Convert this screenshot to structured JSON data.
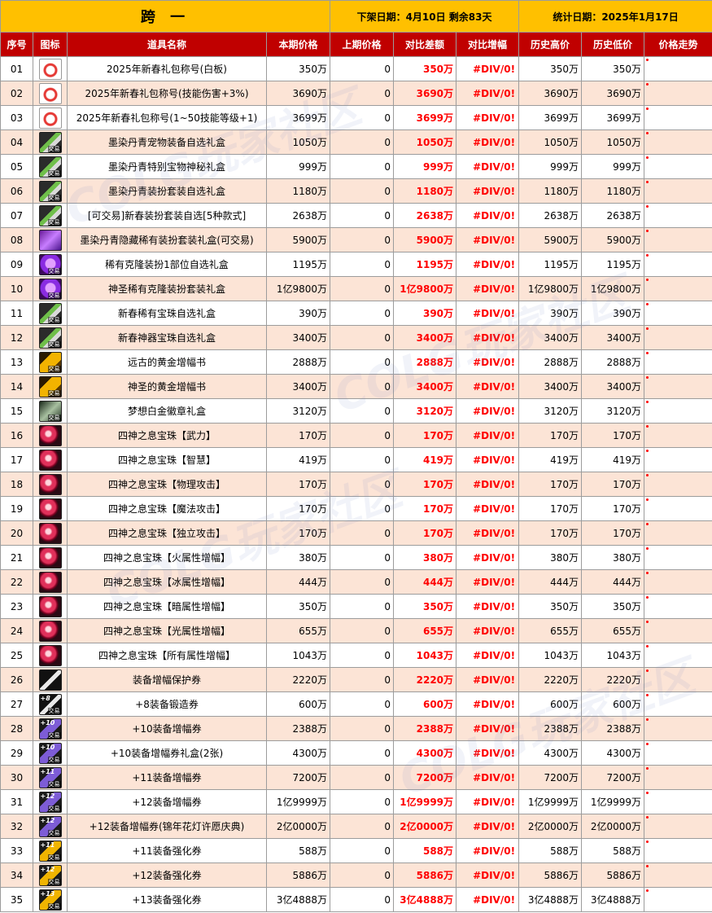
{
  "header": {
    "server": "跨 一",
    "offline_info": "下架日期：4月10日   剩余83天",
    "stat_info": "统计日期：2025年1月17日"
  },
  "columns": [
    "序号",
    "图标",
    "道具名称",
    "本期价格",
    "上期价格",
    "对比差额",
    "对比增幅",
    "历史高价",
    "历史低价",
    "价格走势"
  ],
  "watermark": "COLG玩家社区",
  "rows": [
    {
      "no": "01",
      "icon": "gift-icon",
      "tag": "",
      "name": "2025年新春礼包称号(白板)",
      "price": "350万",
      "prev": "0",
      "diff": "350万",
      "rate": "#DIV/0!",
      "high": "350万",
      "low": "350万"
    },
    {
      "no": "02",
      "icon": "gift-icon",
      "tag": "",
      "name": "2025年新春礼包称号(技能伤害+3%)",
      "price": "3690万",
      "prev": "0",
      "diff": "3690万",
      "rate": "#DIV/0!",
      "high": "3690万",
      "low": "3690万"
    },
    {
      "no": "03",
      "icon": "gift-icon",
      "tag": "",
      "name": "2025年新春礼包称号(1~50技能等级+1)",
      "price": "3699万",
      "prev": "0",
      "diff": "3699万",
      "rate": "#DIV/0!",
      "high": "3699万",
      "low": "3699万"
    },
    {
      "no": "04",
      "icon": "brush-icon",
      "tag": "交易",
      "name": "墨染丹青宠物装备自选礼盒",
      "price": "1050万",
      "prev": "0",
      "diff": "1050万",
      "rate": "#DIV/0!",
      "high": "1050万",
      "low": "1050万"
    },
    {
      "no": "05",
      "icon": "brush-icon",
      "tag": "交易",
      "name": "墨染丹青特别宝物神秘礼盒",
      "price": "999万",
      "prev": "0",
      "diff": "999万",
      "rate": "#DIV/0!",
      "high": "999万",
      "low": "999万"
    },
    {
      "no": "06",
      "icon": "brush-icon",
      "tag": "交易",
      "name": "墨染丹青装扮套装自选礼盒",
      "price": "1180万",
      "prev": "0",
      "diff": "1180万",
      "rate": "#DIV/0!",
      "high": "1180万",
      "low": "1180万"
    },
    {
      "no": "07",
      "icon": "brush-icon",
      "tag": "交易",
      "name": "[可交易]新春装扮套装自选[5种款式]",
      "price": "2638万",
      "prev": "0",
      "diff": "2638万",
      "rate": "#DIV/0!",
      "high": "2638万",
      "low": "2638万"
    },
    {
      "no": "08",
      "icon": "box-icon",
      "tag": "",
      "name": "墨染丹青隐藏稀有装扮套装礼盒(可交易)",
      "price": "5900万",
      "prev": "0",
      "diff": "5900万",
      "rate": "#DIV/0!",
      "high": "5900万",
      "low": "5900万"
    },
    {
      "no": "09",
      "icon": "ghost-icon",
      "tag": "交易",
      "name": "稀有克隆装扮1部位自选礼盒",
      "price": "1195万",
      "prev": "0",
      "diff": "1195万",
      "rate": "#DIV/0!",
      "high": "1195万",
      "low": "1195万"
    },
    {
      "no": "10",
      "icon": "ghost-icon",
      "tag": "交易",
      "name": "神圣稀有克隆装扮套装礼盒",
      "price": "1亿9800万",
      "prev": "0",
      "diff": "1亿9800万",
      "rate": "#DIV/0!",
      "high": "1亿9800万",
      "low": "1亿9800万"
    },
    {
      "no": "11",
      "icon": "brush-icon",
      "tag": "交易",
      "name": "新春稀有宝珠自选礼盒",
      "price": "390万",
      "prev": "0",
      "diff": "390万",
      "rate": "#DIV/0!",
      "high": "390万",
      "low": "390万"
    },
    {
      "no": "12",
      "icon": "brush-icon",
      "tag": "交易",
      "name": "新春神器宝珠自选礼盒",
      "price": "3400万",
      "prev": "0",
      "diff": "3400万",
      "rate": "#DIV/0!",
      "high": "3400万",
      "low": "3400万"
    },
    {
      "no": "13",
      "icon": "book-icon",
      "tag": "交易",
      "name": "远古的黄金增幅书",
      "price": "2888万",
      "prev": "0",
      "diff": "2888万",
      "rate": "#DIV/0!",
      "high": "2888万",
      "low": "2888万"
    },
    {
      "no": "14",
      "icon": "book-icon",
      "tag": "交易",
      "name": "神圣的黄金增幅书",
      "price": "3400万",
      "prev": "0",
      "diff": "3400万",
      "rate": "#DIV/0!",
      "high": "3400万",
      "low": "3400万"
    },
    {
      "no": "15",
      "icon": "badge-icon",
      "tag": "交易",
      "name": "梦想白金徽章礼盒",
      "price": "3120万",
      "prev": "0",
      "diff": "3120万",
      "rate": "#DIV/0!",
      "high": "3120万",
      "low": "3120万"
    },
    {
      "no": "16",
      "icon": "orb-icon",
      "tag": "",
      "name": "四神之息宝珠【武力】",
      "price": "170万",
      "prev": "0",
      "diff": "170万",
      "rate": "#DIV/0!",
      "high": "170万",
      "low": "170万"
    },
    {
      "no": "17",
      "icon": "orb-icon",
      "tag": "",
      "name": "四神之息宝珠【智慧】",
      "price": "419万",
      "prev": "0",
      "diff": "419万",
      "rate": "#DIV/0!",
      "high": "419万",
      "low": "419万"
    },
    {
      "no": "18",
      "icon": "orb-icon",
      "tag": "",
      "name": "四神之息宝珠【物理攻击】",
      "price": "170万",
      "prev": "0",
      "diff": "170万",
      "rate": "#DIV/0!",
      "high": "170万",
      "low": "170万"
    },
    {
      "no": "19",
      "icon": "orb-icon",
      "tag": "",
      "name": "四神之息宝珠【魔法攻击】",
      "price": "170万",
      "prev": "0",
      "diff": "170万",
      "rate": "#DIV/0!",
      "high": "170万",
      "low": "170万"
    },
    {
      "no": "20",
      "icon": "orb-icon",
      "tag": "",
      "name": "四神之息宝珠【独立攻击】",
      "price": "170万",
      "prev": "0",
      "diff": "170万",
      "rate": "#DIV/0!",
      "high": "170万",
      "low": "170万"
    },
    {
      "no": "21",
      "icon": "orb-icon",
      "tag": "",
      "name": "四神之息宝珠【火属性增幅】",
      "price": "380万",
      "prev": "0",
      "diff": "380万",
      "rate": "#DIV/0!",
      "high": "380万",
      "low": "380万"
    },
    {
      "no": "22",
      "icon": "orb-icon",
      "tag": "",
      "name": "四神之息宝珠【冰属性增幅】",
      "price": "444万",
      "prev": "0",
      "diff": "444万",
      "rate": "#DIV/0!",
      "high": "444万",
      "low": "444万"
    },
    {
      "no": "23",
      "icon": "orb-icon",
      "tag": "",
      "name": "四神之息宝珠【暗属性增幅】",
      "price": "350万",
      "prev": "0",
      "diff": "350万",
      "rate": "#DIV/0!",
      "high": "350万",
      "low": "350万"
    },
    {
      "no": "24",
      "icon": "orb-icon",
      "tag": "",
      "name": "四神之息宝珠【光属性增幅】",
      "price": "655万",
      "prev": "0",
      "diff": "655万",
      "rate": "#DIV/0!",
      "high": "655万",
      "low": "655万"
    },
    {
      "no": "25",
      "icon": "orb-icon",
      "tag": "",
      "name": "四神之息宝珠【所有属性增幅】",
      "price": "1043万",
      "prev": "0",
      "diff": "1043万",
      "rate": "#DIV/0!",
      "high": "1043万",
      "low": "1043万"
    },
    {
      "no": "26",
      "icon": "ticket-icon",
      "tag": "",
      "name": "装备增幅保护券",
      "price": "2220万",
      "prev": "0",
      "diff": "2220万",
      "rate": "#DIV/0!",
      "high": "2220万",
      "low": "2220万"
    },
    {
      "no": "27",
      "icon": "ticket-icon",
      "tag": "交易",
      "plus": "+8",
      "name": "+8装备锻造券",
      "price": "600万",
      "prev": "0",
      "diff": "600万",
      "rate": "#DIV/0!",
      "high": "600万",
      "low": "600万"
    },
    {
      "no": "28",
      "icon": "plus-ticket-icon",
      "tag": "交易",
      "plus": "+10",
      "name": "+10装备增幅券",
      "price": "2388万",
      "prev": "0",
      "diff": "2388万",
      "rate": "#DIV/0!",
      "high": "2388万",
      "low": "2388万"
    },
    {
      "no": "29",
      "icon": "plus-ticket-icon",
      "tag": "交易",
      "plus": "+10",
      "name": "+10装备增幅券礼盒(2张)",
      "price": "4300万",
      "prev": "0",
      "diff": "4300万",
      "rate": "#DIV/0!",
      "high": "4300万",
      "low": "4300万"
    },
    {
      "no": "30",
      "icon": "plus-ticket-icon",
      "tag": "交易",
      "plus": "+11",
      "name": "+11装备增幅券",
      "price": "7200万",
      "prev": "0",
      "diff": "7200万",
      "rate": "#DIV/0!",
      "high": "7200万",
      "low": "7200万"
    },
    {
      "no": "31",
      "icon": "plus-ticket-icon",
      "tag": "交易",
      "plus": "+12",
      "name": "+12装备增幅券",
      "price": "1亿9999万",
      "prev": "0",
      "diff": "1亿9999万",
      "rate": "#DIV/0!",
      "high": "1亿9999万",
      "low": "1亿9999万"
    },
    {
      "no": "32",
      "icon": "plus-ticket-icon",
      "tag": "交易",
      "plus": "+12",
      "name": "+12装备增幅券(锦年花灯许愿庆典)",
      "price": "2亿0000万",
      "prev": "0",
      "diff": "2亿0000万",
      "rate": "#DIV/0!",
      "high": "2亿0000万",
      "low": "2亿0000万"
    },
    {
      "no": "33",
      "icon": "gold-ticket-icon",
      "tag": "交易",
      "plus": "+11",
      "name": "+11装备强化券",
      "price": "588万",
      "prev": "0",
      "diff": "588万",
      "rate": "#DIV/0!",
      "high": "588万",
      "low": "588万"
    },
    {
      "no": "34",
      "icon": "gold-ticket-icon",
      "tag": "交易",
      "plus": "+12",
      "name": "+12装备强化券",
      "price": "5886万",
      "prev": "0",
      "diff": "5886万",
      "rate": "#DIV/0!",
      "high": "5886万",
      "low": "5886万"
    },
    {
      "no": "35",
      "icon": "gold-ticket-icon",
      "tag": "交易",
      "plus": "+13",
      "name": "+13装备强化券",
      "price": "3亿4888万",
      "prev": "0",
      "diff": "3亿4888万",
      "rate": "#DIV/0!",
      "high": "3亿4888万",
      "low": "3亿4888万"
    }
  ]
}
